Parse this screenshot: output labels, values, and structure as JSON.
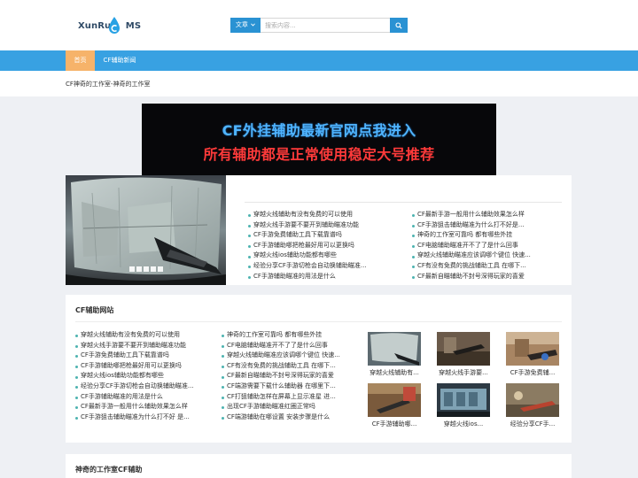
{
  "header": {
    "logo_text_a": "XunRui",
    "logo_text_b": "MS",
    "search_category": "文章",
    "search_placeholder": "搜索内容..."
  },
  "nav": {
    "items": [
      {
        "label": "首页",
        "active": true
      },
      {
        "label": "CF辅助新闻",
        "active": false
      }
    ]
  },
  "breadcrumb": "CF神奇的工作室-神奇的工作室",
  "banner": {
    "line1": "CF外挂辅助最新官网点我进入",
    "line2": "所有辅助都是正常使用稳定大号推荐"
  },
  "featured": {
    "left_links": [
      "穿越火线辅助有没有免费的可以使用",
      "穿越火线手游要不要开到辅助瞄准功能",
      "CF手游免费辅助工具下载靠谱吗",
      "CF手游辅助哪把枪最好用可以更换吗",
      "穿越火线ios辅助功能都有哪些",
      "经验分享CF手游切枪会自动换辅助瞄准...",
      "CF手游辅助瞄准的用法是什么"
    ],
    "right_links": [
      "CF最新手游一般用什么辅助效果怎么样",
      "CF手游狙击辅助瞄准为什么打不好是...",
      "神奇的工作室可靠吗 都有哪些外挂",
      "CF电脑辅助瞄准开不了了是什么回事",
      "穿越火线辅助瞄准应该调哪个键位 快速...",
      "CF有没有免费的挑战辅助工具 在哪下...",
      "CF最新自瞄辅助不封号深得玩家的喜爱"
    ]
  },
  "section2": {
    "title": "CF辅助网站",
    "col1": [
      "穿越火线辅助有没有免费的可以使用",
      "穿越火线手游要不要开到辅助瞄准功能",
      "CF手游免费辅助工具下载靠谱吗",
      "CF手游辅助哪把枪最好用可以更换吗",
      "穿越火线ios辅助功能都有哪些",
      "经验分享CF手游切枪会自动换辅助瞄准...",
      "CF手游辅助瞄准的用法是什么",
      "CF最新手游一般用什么辅助效果怎么样",
      "CF手游狙击辅助瞄准为什么打不好 是..."
    ],
    "col2": [
      "神奇的工作室可靠吗 都有哪些外挂",
      "CF电脑辅助瞄准开不了了是什么回事",
      "穿越火线辅助瞄准应该调哪个键位 快速...",
      "CF有没有免费的挑战辅助工具 在哪下...",
      "CF最新自瞄辅助不封号深得玩家的喜爱",
      "CF端游需要下载什么辅助器 在哪里下...",
      "CF打狙辅助怎样在屏幕上显示准星 进...",
      "出现CF手游辅助瞄准红圈正常吗",
      "CF端游辅助在哪设置 安装步骤是什么"
    ],
    "thumbs": [
      "穿越火线辅助有...",
      "穿越火线手游要...",
      "CF手游免费辅...",
      "CF手游辅助哪...",
      "穿越火线ios...",
      "经验分享CF手..."
    ]
  },
  "section3": {
    "title": "神奇的工作室CF辅助"
  },
  "colors": {
    "nav_bg": "#38a1e2",
    "nav_active": "#f6b36a",
    "accent": "#2a92d3",
    "bullet": "#4db3b0"
  }
}
